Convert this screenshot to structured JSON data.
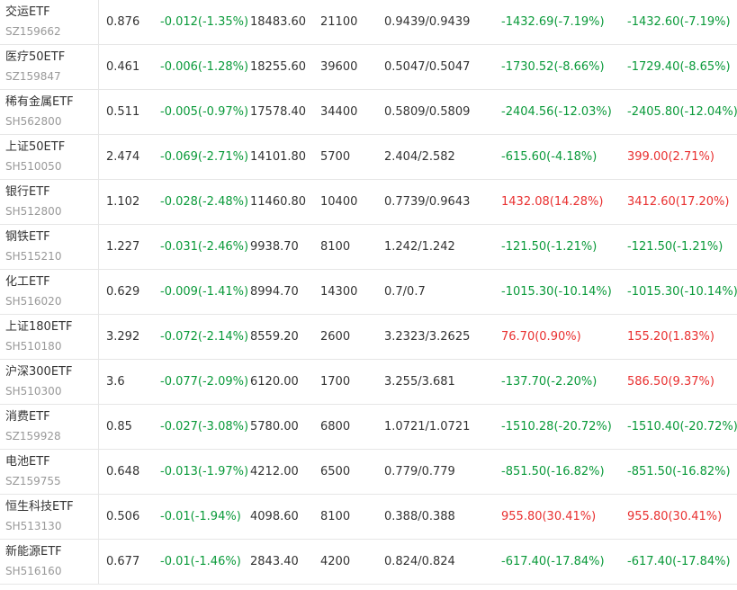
{
  "colors": {
    "up": "#e93030",
    "down": "#0a9a3a",
    "text": "#333333",
    "code": "#999999"
  },
  "rows": [
    {
      "name": "交运ETF",
      "code": "SZ159662",
      "price": "0.876",
      "change": "-0.012(-1.35%)",
      "amount": "18483.60",
      "shares": "21100",
      "cost": "0.9439/0.9439",
      "pnl1": "-1432.69(-7.19%)",
      "pnl1_dir": "down",
      "pnl2": "-1432.60(-7.19%)",
      "pnl2_dir": "down"
    },
    {
      "name": "医疗50ETF",
      "code": "SZ159847",
      "price": "0.461",
      "change": "-0.006(-1.28%)",
      "amount": "18255.60",
      "shares": "39600",
      "cost": "0.5047/0.5047",
      "pnl1": "-1730.52(-8.66%)",
      "pnl1_dir": "down",
      "pnl2": "-1729.40(-8.65%)",
      "pnl2_dir": "down"
    },
    {
      "name": "稀有金属ETF",
      "code": "SH562800",
      "price": "0.511",
      "change": "-0.005(-0.97%)",
      "amount": "17578.40",
      "shares": "34400",
      "cost": "0.5809/0.5809",
      "pnl1": "-2404.56(-12.03%)",
      "pnl1_dir": "down",
      "pnl2": "-2405.80(-12.04%)",
      "pnl2_dir": "down"
    },
    {
      "name": "上证50ETF",
      "code": "SH510050",
      "price": "2.474",
      "change": "-0.069(-2.71%)",
      "amount": "14101.80",
      "shares": "5700",
      "cost": "2.404/2.582",
      "pnl1": "-615.60(-4.18%)",
      "pnl1_dir": "down",
      "pnl2": "399.00(2.71%)",
      "pnl2_dir": "up"
    },
    {
      "name": "银行ETF",
      "code": "SH512800",
      "price": "1.102",
      "change": "-0.028(-2.48%)",
      "amount": "11460.80",
      "shares": "10400",
      "cost": "0.7739/0.9643",
      "pnl1": "1432.08(14.28%)",
      "pnl1_dir": "up",
      "pnl2": "3412.60(17.20%)",
      "pnl2_dir": "up"
    },
    {
      "name": "钢铁ETF",
      "code": "SH515210",
      "price": "1.227",
      "change": "-0.031(-2.46%)",
      "amount": "9938.70",
      "shares": "8100",
      "cost": "1.242/1.242",
      "pnl1": "-121.50(-1.21%)",
      "pnl1_dir": "down",
      "pnl2": "-121.50(-1.21%)",
      "pnl2_dir": "down"
    },
    {
      "name": "化工ETF",
      "code": "SH516020",
      "price": "0.629",
      "change": "-0.009(-1.41%)",
      "amount": "8994.70",
      "shares": "14300",
      "cost": "0.7/0.7",
      "pnl1": "-1015.30(-10.14%)",
      "pnl1_dir": "down",
      "pnl2": "-1015.30(-10.14%)",
      "pnl2_dir": "down"
    },
    {
      "name": "上证180ETF",
      "code": "SH510180",
      "price": "3.292",
      "change": "-0.072(-2.14%)",
      "amount": "8559.20",
      "shares": "2600",
      "cost": "3.2323/3.2625",
      "pnl1": "76.70(0.90%)",
      "pnl1_dir": "up",
      "pnl2": "155.20(1.83%)",
      "pnl2_dir": "up"
    },
    {
      "name": "沪深300ETF",
      "code": "SH510300",
      "price": "3.6",
      "change": "-0.077(-2.09%)",
      "amount": "6120.00",
      "shares": "1700",
      "cost": "3.255/3.681",
      "pnl1": "-137.70(-2.20%)",
      "pnl1_dir": "down",
      "pnl2": "586.50(9.37%)",
      "pnl2_dir": "up"
    },
    {
      "name": "消费ETF",
      "code": "SZ159928",
      "price": "0.85",
      "change": "-0.027(-3.08%)",
      "amount": "5780.00",
      "shares": "6800",
      "cost": "1.0721/1.0721",
      "pnl1": "-1510.28(-20.72%)",
      "pnl1_dir": "down",
      "pnl2": "-1510.40(-20.72%)",
      "pnl2_dir": "down"
    },
    {
      "name": "电池ETF",
      "code": "SZ159755",
      "price": "0.648",
      "change": "-0.013(-1.97%)",
      "amount": "4212.00",
      "shares": "6500",
      "cost": "0.779/0.779",
      "pnl1": "-851.50(-16.82%)",
      "pnl1_dir": "down",
      "pnl2": "-851.50(-16.82%)",
      "pnl2_dir": "down"
    },
    {
      "name": "恒生科技ETF",
      "code": "SH513130",
      "price": "0.506",
      "change": "-0.01(-1.94%)",
      "amount": "4098.60",
      "shares": "8100",
      "cost": "0.388/0.388",
      "pnl1": "955.80(30.41%)",
      "pnl1_dir": "up",
      "pnl2": "955.80(30.41%)",
      "pnl2_dir": "up"
    },
    {
      "name": "新能源ETF",
      "code": "SH516160",
      "price": "0.677",
      "change": "-0.01(-1.46%)",
      "amount": "2843.40",
      "shares": "4200",
      "cost": "0.824/0.824",
      "pnl1": "-617.40(-17.84%)",
      "pnl1_dir": "down",
      "pnl2": "-617.40(-17.84%)",
      "pnl2_dir": "down"
    }
  ]
}
